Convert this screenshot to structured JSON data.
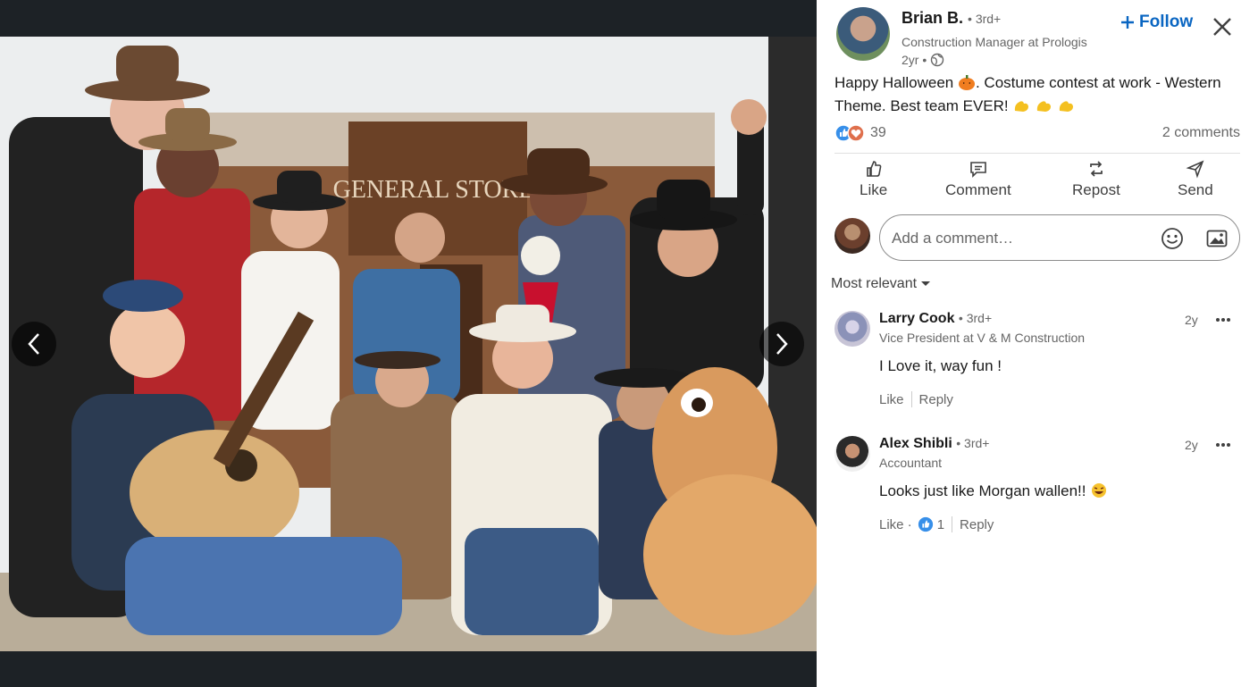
{
  "viewer": {
    "photo_alt": "Group photo of coworkers in western costumes",
    "backdrop_sign": "GENERAL STORE",
    "prev_icon": "chevron-left-icon",
    "next_icon": "chevron-right-icon"
  },
  "author": {
    "name": "Brian B.",
    "degree": "• 3rd+",
    "headline": "Construction Manager at Prologis",
    "time": "2yr •",
    "visibility_icon": "globe-icon"
  },
  "follow": {
    "label": "Follow",
    "icon": "plus-icon"
  },
  "close_icon": "close-icon",
  "post": {
    "line1_a": "Happy Halloween",
    "line1_b": ". Costume contest at work - Western",
    "line2": "Theme. Best team EVER!",
    "emojis": [
      "pumpkin-emoji",
      "flexed-biceps-emoji",
      "flexed-biceps-emoji",
      "flexed-biceps-emoji"
    ]
  },
  "social": {
    "reaction_count": "39",
    "reaction_icons": [
      "like-reaction-icon",
      "love-reaction-icon"
    ],
    "comments": "2 comments"
  },
  "actions": [
    {
      "label": "Like",
      "icon": "thumbs-up-icon"
    },
    {
      "label": "Comment",
      "icon": "speech-bubble-icon"
    },
    {
      "label": "Repost",
      "icon": "repost-icon"
    },
    {
      "label": "Send",
      "icon": "paper-plane-icon"
    }
  ],
  "comment_box": {
    "placeholder": "Add a comment…",
    "icons": [
      "emoji-icon",
      "image-icon"
    ]
  },
  "sort": {
    "label": "Most relevant"
  },
  "comments": [
    {
      "name": "Larry Cook",
      "degree": "• 3rd+",
      "headline": "Vice President at V & M Construction",
      "time": "2y",
      "text": "I Love it, way fun !",
      "like": "Like",
      "reply": "Reply",
      "reactions": ""
    },
    {
      "name": "Alex Shibli",
      "degree": "• 3rd+",
      "headline": "Accountant",
      "time": "2y",
      "text": "Looks just like Morgan wallen!!",
      "like": "Like ·",
      "reply": "Reply",
      "reactions": "1"
    }
  ],
  "colors": {
    "accent": "#0a66c2",
    "viewer_bg": "#1d2226",
    "text": "#191919",
    "muted": "#666666"
  }
}
